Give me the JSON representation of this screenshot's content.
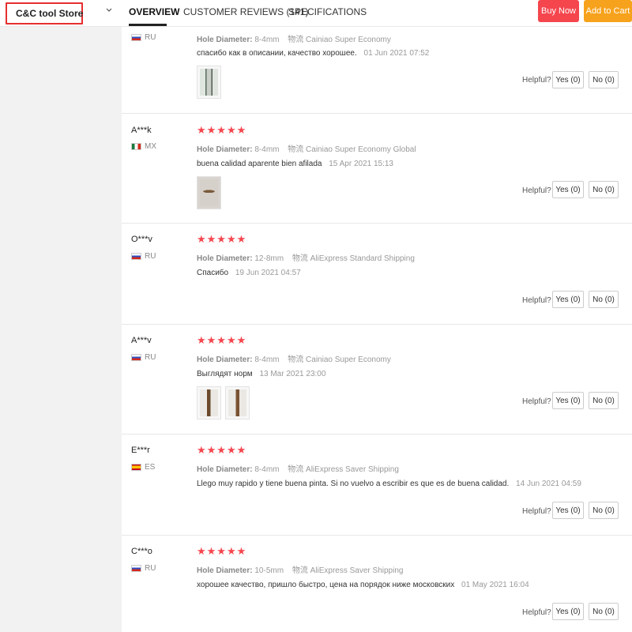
{
  "store": {
    "name": "C&C tool Store"
  },
  "tabs": [
    {
      "label": "OVERVIEW"
    },
    {
      "label": "CUSTOMER REVIEWS (141)"
    },
    {
      "label": "SPECIFICATIONS"
    }
  ],
  "actions": {
    "buy_now": "Buy Now",
    "add_to_cart": "Add to Cart"
  },
  "reviews": [
    {
      "reviewer": "",
      "country": "RU",
      "stars": "",
      "attr_label": "Hole Diameter:",
      "attr_value": "8-4mm",
      "shipping": "物流 Cainiao Super Economy",
      "text": "спасибо как в описании, качество хорошее.",
      "date": "01 Jun 2021 07:52",
      "helpful": "Helpful?",
      "yes": "Yes (0)",
      "no": "No (0)"
    },
    {
      "reviewer": "A***k",
      "country": "MX",
      "stars": "★★★★★",
      "attr_label": "Hole Diameter:",
      "attr_value": "8-4mm",
      "shipping": "物流 Cainiao Super Economy Global",
      "text": "buena calidad aparente bien afilada",
      "date": "15 Apr 2021 15:13",
      "helpful": "Helpful?",
      "yes": "Yes (0)",
      "no": "No (0)"
    },
    {
      "reviewer": "O***v",
      "country": "RU",
      "stars": "★★★★★",
      "attr_label": "Hole Diameter:",
      "attr_value": "12-8mm",
      "shipping": "物流 AliExpress Standard Shipping",
      "text": "Спасибо",
      "date": "19 Jun 2021 04:57",
      "helpful": "Helpful?",
      "yes": "Yes (0)",
      "no": "No (0)"
    },
    {
      "reviewer": "A***v",
      "country": "RU",
      "stars": "★★★★★",
      "attr_label": "Hole Diameter:",
      "attr_value": "8-4mm",
      "shipping": "物流 Cainiao Super Economy",
      "text": "Выглядят норм",
      "date": "13 Mar 2021 23:00",
      "helpful": "Helpful?",
      "yes": "Yes (0)",
      "no": "No (0)"
    },
    {
      "reviewer": "E***r",
      "country": "ES",
      "stars": "★★★★★",
      "attr_label": "Hole Diameter:",
      "attr_value": "8-4mm",
      "shipping": "物流 AliExpress Saver Shipping",
      "text": "Llego muy rapido y tiene buena pinta. Si no vuelvo a escribir es que es de buena calidad.",
      "date": "14 Jun 2021 04:59",
      "helpful": "Helpful?",
      "yes": "Yes (0)",
      "no": "No (0)"
    },
    {
      "reviewer": "C***o",
      "country": "RU",
      "stars": "★★★★★",
      "attr_label": "Hole Diameter:",
      "attr_value": "10-5mm",
      "shipping": "物流 AliExpress Saver Shipping",
      "text": "хорошее качество, пришло быстро, цена на порядок ниже московских",
      "date": "01 May 2021 16:04",
      "helpful": "Helpful?",
      "yes": "Yes (0)",
      "no": "No (0)"
    }
  ]
}
